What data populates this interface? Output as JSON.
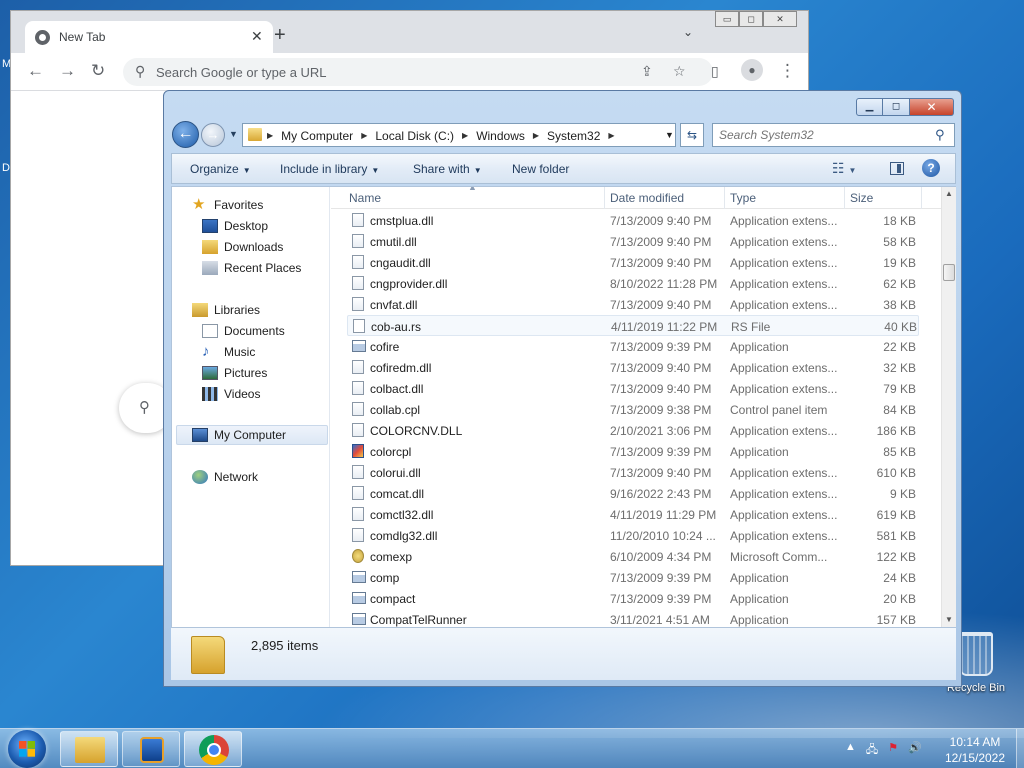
{
  "desktop": {
    "recycle_bin_label": "Recycle Bin",
    "left_edge_chars": [
      "M",
      "D"
    ]
  },
  "chrome": {
    "tab_title": "New Tab",
    "tab_close": "✕",
    "new_tab": "+",
    "tab_menu": "⌄",
    "omnibox_placeholder": "Search Google or type a URL",
    "min_btn": "▭",
    "max_btn": "◻",
    "close_btn": "✕"
  },
  "explorer": {
    "breadcrumbs": [
      "My Computer",
      "Local Disk (C:)",
      "Windows",
      "System32"
    ],
    "search_placeholder": "Search System32",
    "commands": {
      "organize": "Organize",
      "include": "Include in library",
      "share": "Share with",
      "new_folder": "New folder"
    },
    "nav": {
      "favorites": "Favorites",
      "desktop": "Desktop",
      "downloads": "Downloads",
      "recent": "Recent Places",
      "libraries": "Libraries",
      "documents": "Documents",
      "music": "Music",
      "pictures": "Pictures",
      "videos": "Videos",
      "computer": "My Computer",
      "network": "Network"
    },
    "columns": {
      "name": "Name",
      "date": "Date modified",
      "type": "Type",
      "size": "Size"
    },
    "files": [
      {
        "name": "cmstplua.dll",
        "date": "7/13/2009 9:40 PM",
        "type": "Application extens...",
        "size": "18 KB",
        "icon": "dll"
      },
      {
        "name": "cmutil.dll",
        "date": "7/13/2009 9:40 PM",
        "type": "Application extens...",
        "size": "58 KB",
        "icon": "dll"
      },
      {
        "name": "cngaudit.dll",
        "date": "7/13/2009 9:40 PM",
        "type": "Application extens...",
        "size": "19 KB",
        "icon": "dll"
      },
      {
        "name": "cngprovider.dll",
        "date": "8/10/2022 11:28 PM",
        "type": "Application extens...",
        "size": "62 KB",
        "icon": "dll"
      },
      {
        "name": "cnvfat.dll",
        "date": "7/13/2009 9:40 PM",
        "type": "Application extens...",
        "size": "38 KB",
        "icon": "dll"
      },
      {
        "name": "cob-au.rs",
        "date": "4/11/2019 11:22 PM",
        "type": "RS File",
        "size": "40 KB",
        "icon": "blank"
      },
      {
        "name": "cofire",
        "date": "7/13/2009 9:39 PM",
        "type": "Application",
        "size": "22 KB",
        "icon": "app"
      },
      {
        "name": "cofiredm.dll",
        "date": "7/13/2009 9:40 PM",
        "type": "Application extens...",
        "size": "32 KB",
        "icon": "dll"
      },
      {
        "name": "colbact.dll",
        "date": "7/13/2009 9:40 PM",
        "type": "Application extens...",
        "size": "79 KB",
        "icon": "dll"
      },
      {
        "name": "collab.cpl",
        "date": "7/13/2009 9:38 PM",
        "type": "Control panel item",
        "size": "84 KB",
        "icon": "dll"
      },
      {
        "name": "COLORCNV.DLL",
        "date": "2/10/2021 3:06 PM",
        "type": "Application extens...",
        "size": "186 KB",
        "icon": "dll"
      },
      {
        "name": "colorcpl",
        "date": "7/13/2009 9:39 PM",
        "type": "Application",
        "size": "85 KB",
        "icon": "color"
      },
      {
        "name": "colorui.dll",
        "date": "7/13/2009 9:40 PM",
        "type": "Application extens...",
        "size": "610 KB",
        "icon": "dll"
      },
      {
        "name": "comcat.dll",
        "date": "9/16/2022 2:43 PM",
        "type": "Application extens...",
        "size": "9 KB",
        "icon": "dll"
      },
      {
        "name": "comctl32.dll",
        "date": "4/11/2019 11:29 PM",
        "type": "Application extens...",
        "size": "619 KB",
        "icon": "dll"
      },
      {
        "name": "comdlg32.dll",
        "date": "11/20/2010 10:24 ...",
        "type": "Application extens...",
        "size": "581 KB",
        "icon": "dll"
      },
      {
        "name": "comexp",
        "date": "6/10/2009 4:34 PM",
        "type": "Microsoft Comm...",
        "size": "122 KB",
        "icon": "msc"
      },
      {
        "name": "comp",
        "date": "7/13/2009 9:39 PM",
        "type": "Application",
        "size": "24 KB",
        "icon": "app"
      },
      {
        "name": "compact",
        "date": "7/13/2009 9:39 PM",
        "type": "Application",
        "size": "20 KB",
        "icon": "app"
      },
      {
        "name": "CompatTelRunner",
        "date": "3/11/2021 4:51 AM",
        "type": "Application",
        "size": "157 KB",
        "icon": "app"
      }
    ],
    "item_count": "2,895 items"
  },
  "taskbar": {
    "time": "10:14 AM",
    "date": "12/15/2022"
  }
}
